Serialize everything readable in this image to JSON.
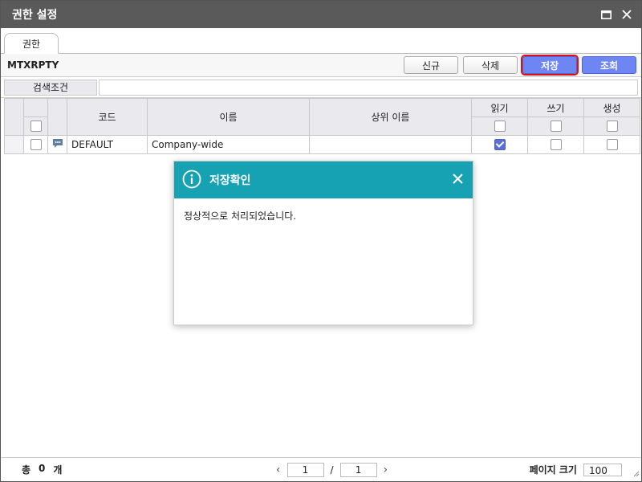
{
  "window": {
    "title": "권한 설정"
  },
  "tabs": [
    {
      "label": "권한"
    }
  ],
  "toolbar": {
    "code": "MTXRPTY",
    "buttons": {
      "new": "신규",
      "delete": "삭제",
      "save": "저장",
      "search": "조회"
    }
  },
  "search": {
    "label": "검색조건",
    "value": ""
  },
  "grid": {
    "headers": {
      "code": "코드",
      "name": "이름",
      "parent_name": "상위 이름",
      "read": "읽기",
      "write": "쓰기",
      "create": "생성"
    },
    "rows": [
      {
        "code": "DEFAULT",
        "name": "Company-wide",
        "parent_name": "",
        "read": true,
        "write": false,
        "create": false
      }
    ]
  },
  "footer": {
    "total_label": "총",
    "total_count": "0",
    "total_unit": "개",
    "page_current": "1",
    "page_separator": "/",
    "page_total": "1",
    "page_size_label": "페이지 크기",
    "page_size": "100"
  },
  "dialog": {
    "title": "저장확인",
    "message": "정상적으로 처리되었습니다."
  },
  "colors": {
    "titlebar": "#5a5a5a",
    "primary_button": "#6e86f3",
    "dialog_header": "#17a2b4",
    "active_outline": "#dd1111"
  }
}
